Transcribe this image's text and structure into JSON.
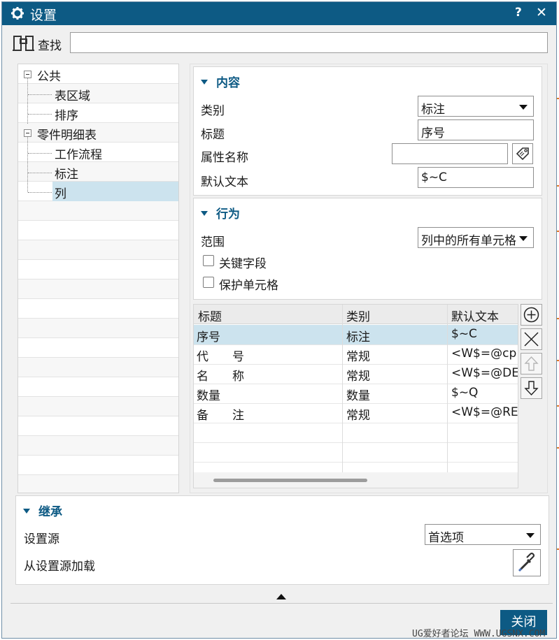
{
  "window": {
    "title": "设置",
    "help": "?",
    "close": "✕"
  },
  "search": {
    "label": "查找",
    "value": ""
  },
  "tree": {
    "nodes": [
      {
        "label": "公共"
      },
      {
        "label": "表区域"
      },
      {
        "label": "排序"
      },
      {
        "label": "零件明细表"
      },
      {
        "label": "工作流程"
      },
      {
        "label": "标注"
      },
      {
        "label": "列"
      }
    ]
  },
  "content": {
    "title": "内容",
    "category_label": "类别",
    "category_value": "标注",
    "title_label": "标题",
    "title_value": "序号",
    "attr_label": "属性名称",
    "attr_value": "",
    "default_label": "默认文本",
    "default_value": "$~C"
  },
  "behavior": {
    "title": "行为",
    "scope_label": "范围",
    "scope_value": "列中的所有单元格",
    "key_field": "关键字段",
    "protect_cell": "保护单元格"
  },
  "grid": {
    "headers": [
      "标题",
      "类别",
      "默认文本"
    ],
    "rows": [
      [
        "序号",
        "标注",
        "$~C"
      ],
      [
        "代　　号",
        "常规",
        "<W$=@cp"
      ],
      [
        "名　　称",
        "常规",
        "<W$=@DE"
      ],
      [
        "数量",
        "数量",
        "$~Q"
      ],
      [
        "备　　注",
        "常规",
        "<W$=@RE"
      ]
    ]
  },
  "inherit": {
    "title": "继承",
    "source_label": "设置源",
    "source_value": "首选项",
    "load_label": "从设置源加载"
  },
  "footer": {
    "close_label": "关闭"
  },
  "watermark": "UG爱好者论坛 WWW.UGSNX.COM",
  "colors": {
    "titlebar": "#0d5a84",
    "selection": "#cce3ee",
    "group_title": "#0d5a84"
  }
}
